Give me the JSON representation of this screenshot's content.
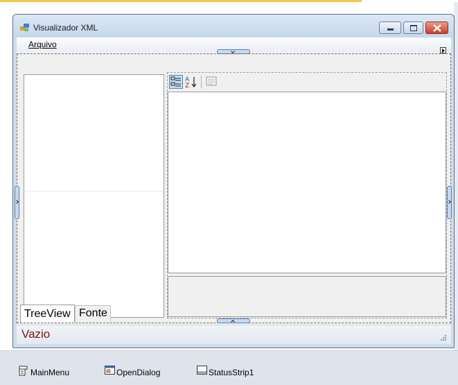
{
  "window": {
    "title": "Visualizador XML"
  },
  "menu": {
    "items": [
      {
        "label": "Arquivo"
      }
    ]
  },
  "tabs": [
    {
      "label": "TreeView",
      "selected": true
    },
    {
      "label": "Fonte",
      "selected": false
    }
  ],
  "status": {
    "text": "Vazio"
  },
  "tray": {
    "components": [
      {
        "label": "MainMenu"
      },
      {
        "label": "OpenDialog"
      },
      {
        "label": "StatusStrip1"
      }
    ]
  },
  "colors": {
    "accent": "#f5c64a",
    "status_text": "#7a1414",
    "window_frame": "#cfdcec"
  },
  "icons": {
    "app": "app-icon",
    "categorized": "categorized-icon",
    "alphabetical": "alphabetical-sort-icon",
    "property_pages": "property-pages-icon"
  }
}
